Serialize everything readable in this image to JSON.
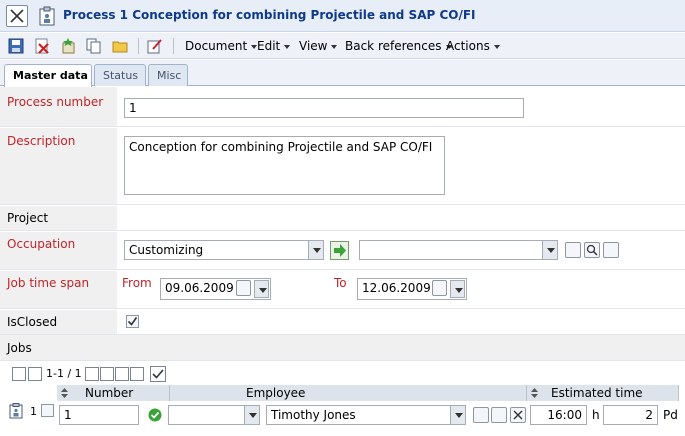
{
  "window": {
    "title": "Process 1 Conception for combining Projectile and SAP CO/FI"
  },
  "toolbar": {
    "icons": [
      "save-icon",
      "delete-icon",
      "new-icon",
      "copy-icon",
      "open-folder-icon",
      "edit-icon"
    ],
    "menus": [
      {
        "label": "Document"
      },
      {
        "label": "Edit"
      },
      {
        "label": "View"
      },
      {
        "label": "Back references"
      },
      {
        "label": "Actions"
      }
    ]
  },
  "tabs": [
    {
      "label": "Master data",
      "active": true
    },
    {
      "label": "Status",
      "active": false
    },
    {
      "label": "Misc",
      "active": false
    }
  ],
  "form": {
    "process_number": {
      "label": "Process number",
      "value": "1"
    },
    "description": {
      "label": "Description",
      "value": "Conception for combining Projectile and SAP CO/FI"
    },
    "project": {
      "label": "Project"
    },
    "occupation": {
      "label": "Occupation",
      "value": "Customizing",
      "second_value": ""
    },
    "job_time_span": {
      "label": "Job time span",
      "from_label": "From",
      "from_value": "09.06.2009",
      "to_label": "To",
      "to_value": "12.06.2009"
    },
    "is_closed": {
      "label": "IsClosed",
      "checked": true
    },
    "jobs": {
      "label": "Jobs"
    }
  },
  "jobs_table": {
    "pager_text": "1-1 / 1",
    "columns": [
      {
        "label": "Number"
      },
      {
        "label": "Employee"
      },
      {
        "label": "Estimated time"
      }
    ],
    "rows": [
      {
        "index": "1",
        "number": "1",
        "status_select": "",
        "employee": "Timothy Jones",
        "time": "16:00",
        "time_unit": "h",
        "days": "2",
        "days_unit": "Pd"
      }
    ]
  },
  "colors": {
    "required_label": "#c0242a",
    "title_text": "#0f3a8a",
    "label_bg": "#f0f0f0",
    "accent_green": "#3aa33a"
  }
}
